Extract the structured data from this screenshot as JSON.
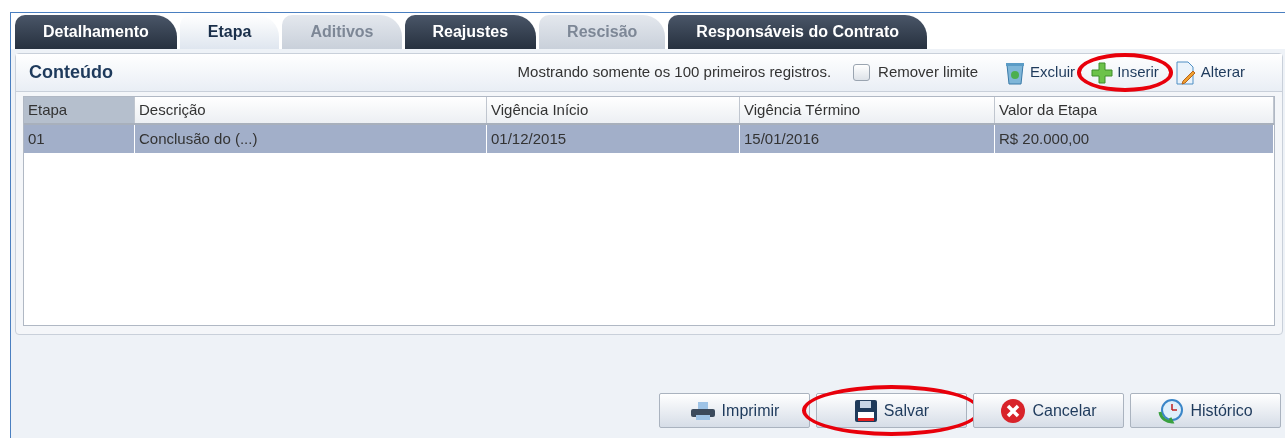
{
  "tabs": [
    {
      "label": "Detalhamento",
      "selected": false,
      "disabled": false
    },
    {
      "label": "Etapa",
      "selected": true,
      "disabled": false
    },
    {
      "label": "Aditivos",
      "selected": false,
      "disabled": true
    },
    {
      "label": "Reajustes",
      "selected": false,
      "disabled": false
    },
    {
      "label": "Rescisão",
      "selected": false,
      "disabled": true
    },
    {
      "label": "Responsáveis do Contrato",
      "selected": false,
      "disabled": false
    }
  ],
  "panel": {
    "title": "Conteúdo",
    "notice": "Mostrando somente os 100 primeiros registros.",
    "remove_limit": {
      "label": "Remover limite",
      "checked": false
    },
    "toolbar": [
      {
        "label": "Excluir",
        "kind": "delete",
        "circled": false
      },
      {
        "label": "Inserir",
        "kind": "insert",
        "circled": true
      },
      {
        "label": "Alterar",
        "kind": "edit",
        "circled": false
      }
    ]
  },
  "table": {
    "columns": [
      "Etapa",
      "Descrição",
      "Vigência Início",
      "Vigência Término",
      "Valor da Etapa"
    ],
    "rows": [
      {
        "cells": [
          "01",
          "Conclusão do (...)",
          "01/12/2015",
          "15/01/2016",
          "R$ 20.000,00"
        ],
        "selected": true
      }
    ]
  },
  "buttons": [
    {
      "label": "Imprimir",
      "kind": "print",
      "circled": false
    },
    {
      "label": "Salvar",
      "kind": "save",
      "circled": true
    },
    {
      "label": "Cancelar",
      "kind": "cancel",
      "circled": false
    },
    {
      "label": "Histórico",
      "kind": "history",
      "circled": false
    }
  ]
}
